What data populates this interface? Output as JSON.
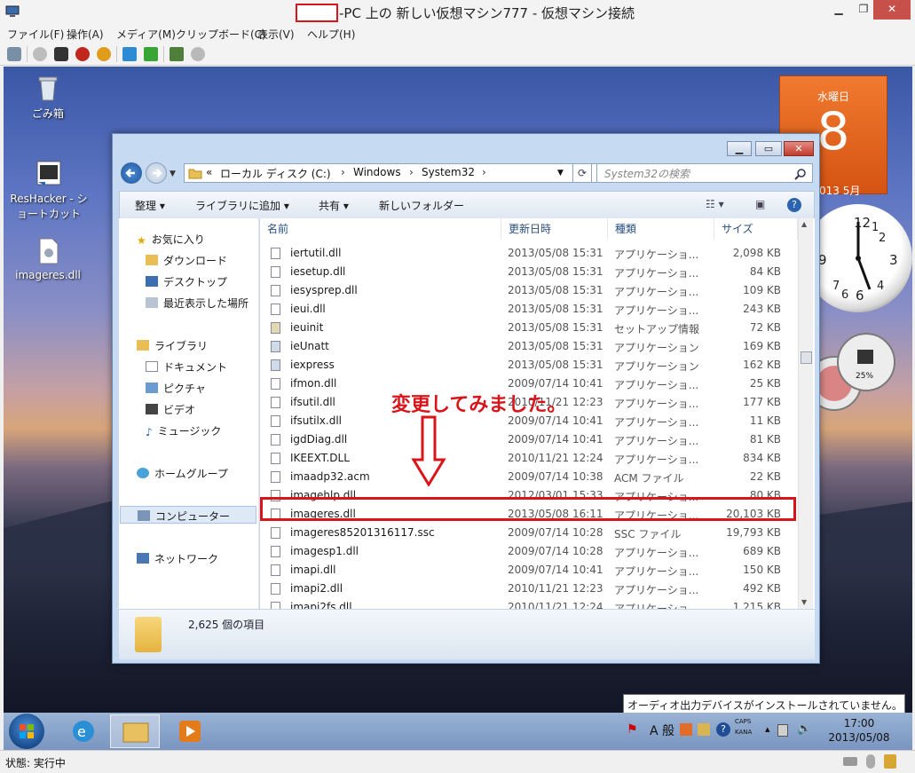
{
  "host": {
    "title": "-PC 上の 新しい仮想マシン777 - 仮想マシン接続",
    "menu": [
      "ファイル(F)",
      "操作(A)",
      "メディア(M)",
      "クリップボード(C)",
      "表示(V)",
      "ヘルプ(H)"
    ],
    "status": "状態: 実行中"
  },
  "desktop": {
    "icons": [
      "ごみ箱",
      "ResHacker - ショートカット",
      "imageres.dll"
    ]
  },
  "calendar": {
    "weekday": "水曜日",
    "day": "8",
    "year_month": "013 5月"
  },
  "meter": {
    "percent_label": "25%"
  },
  "explorer": {
    "breadcrumb": [
      "«",
      "ローカル ディスク (C:)",
      "Windows",
      "System32"
    ],
    "search_placeholder": "System32の検索",
    "commands": [
      "整理 ▾",
      "ライブラリに追加 ▾",
      "共有 ▾",
      "新しいフォルダー"
    ],
    "nav": {
      "favorites": "お気に入り",
      "downloads": "ダウンロード",
      "desktop": "デスクトップ",
      "recent": "最近表示した場所",
      "libraries": "ライブラリ",
      "documents": "ドキュメント",
      "pictures": "ピクチャ",
      "videos": "ビデオ",
      "music": "ミュージック",
      "homegroup": "ホームグループ",
      "computer": "コンピューター",
      "network": "ネットワーク"
    },
    "columns": [
      "名前",
      "更新日時",
      "種類",
      "サイズ"
    ],
    "files": [
      {
        "name": "iertutil.dll",
        "date": "2013/05/08 15:31",
        "type": "アプリケーショ...",
        "size": "2,098 KB"
      },
      {
        "name": "iesetup.dll",
        "date": "2013/05/08 15:31",
        "type": "アプリケーショ...",
        "size": "84 KB"
      },
      {
        "name": "iesysprep.dll",
        "date": "2013/05/08 15:31",
        "type": "アプリケーショ...",
        "size": "109 KB"
      },
      {
        "name": "ieui.dll",
        "date": "2013/05/08 15:31",
        "type": "アプリケーショ...",
        "size": "243 KB"
      },
      {
        "name": "ieuinit",
        "date": "2013/05/08 15:31",
        "type": "セットアップ情報",
        "size": "72 KB"
      },
      {
        "name": "ieUnatt",
        "date": "2013/05/08 15:31",
        "type": "アプリケーション",
        "size": "169 KB"
      },
      {
        "name": "iexpress",
        "date": "2013/05/08 15:31",
        "type": "アプリケーション",
        "size": "162 KB"
      },
      {
        "name": "ifmon.dll",
        "date": "2009/07/14 10:41",
        "type": "アプリケーショ...",
        "size": "25 KB"
      },
      {
        "name": "ifsutil.dll",
        "date": "2010/11/21 12:23",
        "type": "アプリケーショ...",
        "size": "177 KB"
      },
      {
        "name": "ifsutilx.dll",
        "date": "2009/07/14 10:41",
        "type": "アプリケーショ...",
        "size": "11 KB"
      },
      {
        "name": "igdDiag.dll",
        "date": "2009/07/14 10:41",
        "type": "アプリケーショ...",
        "size": "81 KB"
      },
      {
        "name": "IKEEXT.DLL",
        "date": "2010/11/21 12:24",
        "type": "アプリケーショ...",
        "size": "834 KB"
      },
      {
        "name": "imaadp32.acm",
        "date": "2009/07/14 10:38",
        "type": "ACM ファイル",
        "size": "22 KB"
      },
      {
        "name": "imagehlp.dll",
        "date": "2012/03/01 15:33",
        "type": "アプリケーショ...",
        "size": "80 KB"
      },
      {
        "name": "imageres.dll",
        "date": "2013/05/08 16:11",
        "type": "アプリケーショ...",
        "size": "20,103 KB"
      },
      {
        "name": "imageres8520131611​7.ssc",
        "date": "2009/07/14 10:28",
        "type": "SSC ファイル",
        "size": "19,793 KB"
      },
      {
        "name": "imagesp1.dll",
        "date": "2009/07/14 10:28",
        "type": "アプリケーショ...",
        "size": "689 KB"
      },
      {
        "name": "imapi.dll",
        "date": "2009/07/14 10:41",
        "type": "アプリケーショ...",
        "size": "150 KB"
      },
      {
        "name": "imapi2.dll",
        "date": "2010/11/21 12:23",
        "type": "アプリケーショ...",
        "size": "492 KB"
      },
      {
        "name": "imapi2fs.dll",
        "date": "2010/11/21 12:24",
        "type": "アプリケーショ...",
        "size": "1,215 KB"
      }
    ],
    "item_count": "2,625 個の項目"
  },
  "annotation": {
    "text": "変更してみました。",
    "color": "#d9141a"
  },
  "taskbar": {
    "ime": "A 般",
    "caps": "CAPS",
    "kana": "KANA",
    "time": "17:00",
    "date": "2013/05/08",
    "tooltip": "オーディオ出力デバイスがインストールされていません。"
  }
}
